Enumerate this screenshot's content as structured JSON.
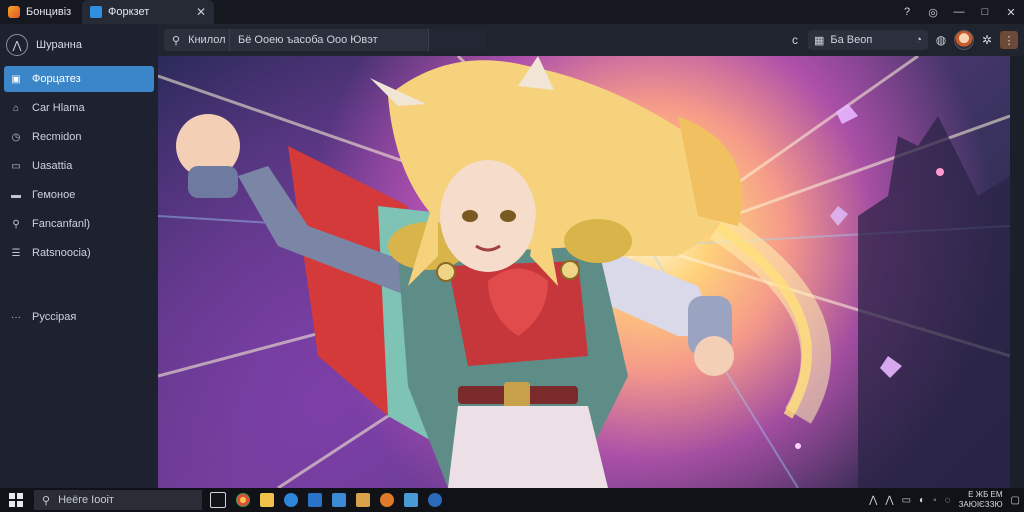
{
  "window": {
    "app_tab_label": "Бонцивіз",
    "active_tab_label": "Форкзет",
    "controls": [
      "?",
      "◎",
      "—",
      "□",
      "✕"
    ]
  },
  "sidebar": {
    "brand_label": "Шуранна",
    "items": [
      {
        "label": "Форцатез",
        "icon": "image-icon",
        "selected": true
      },
      {
        "label": "Car Hlama",
        "icon": "car-icon",
        "selected": false
      },
      {
        "label": "Recmidon",
        "icon": "clock-icon",
        "selected": false
      },
      {
        "label": "Uasattia",
        "icon": "chart-icon",
        "selected": false
      },
      {
        "label": "Гемоное",
        "icon": "folder-icon",
        "selected": false
      },
      {
        "label": "Fancanfanl)",
        "icon": "tag-icon",
        "selected": false
      },
      {
        "label": "Ratsnoocia)",
        "icon": "list-icon",
        "selected": false
      }
    ],
    "more_label": "Руссірая"
  },
  "toolbar": {
    "search_scope": "Книлол",
    "search_value": "Бё Ооею ъасоба Ооо Ювэт",
    "mini_search_value": "Ба Веоп",
    "accent": "#3a86c8"
  },
  "taskbar": {
    "search_placeholder": "Неёге Іооіт",
    "clock_time": "Е ЖБ ЕМ",
    "clock_date": "ЗАЮІЄЗЗЮ"
  }
}
